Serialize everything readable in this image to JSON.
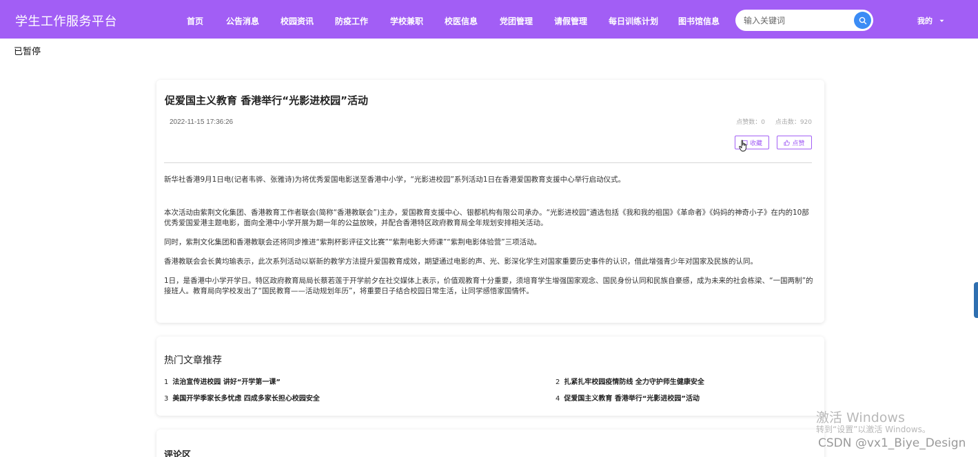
{
  "header": {
    "brand": "学生工作服务平台",
    "nav": [
      "首页",
      "公告消息",
      "校园资讯",
      "防疫工作",
      "学校兼职",
      "校医信息",
      "党团管理",
      "请假管理",
      "每日训练计划",
      "图书馆信息"
    ],
    "search_placeholder": "输入关键词",
    "user_label": "我的",
    "colors": {
      "bar": "#a25ef5",
      "search_button": "#3b8cf5"
    }
  },
  "stray_text": "已暂停",
  "article": {
    "title": "促爱国主义教育 香港举行“光影进校园”活动",
    "date": "2022-11-15 17:36:26",
    "likes_label": "点赞数：0",
    "clicks_label": "点击数：920",
    "collect_button": "收藏",
    "like_button": "点赞",
    "paragraphs": [
      "新华社香港9月1日电(记者韦骅、张雅诗)为将优秀爱国电影送至香港中小学，“光影进校园”系列活动1日在香港爱国教育支援中心举行启动仪式。",
      "本次活动由紫荆文化集团、香港教育工作者联会(简称“香港教联会”)主办，爱国教育支援中心、银都机构有限公司承办。“光影进校园”遴选包括《我和我的祖国》《革命者》《妈妈的神奇小子》在内的10部优秀爱国爱港主题电影，面向全港中小学开展为期一年的公益放映，并配合香港特区政府教育局全年规划安排相关活动。",
      "同时，紫荆文化集团和香港教联会还将同步推进“紫荆杯影评征文比赛”“紫荆电影大师课”“紫荆电影体验营”三项活动。",
      "香港教联会会长黄均瑜表示，此次系列活动以崭新的教学方法提升爱国教育成效，期望通过电影的声、光、影深化学生对国家重要历史事件的认识，借此增强青少年对国家及民族的认同。",
      "1日，是香港中小学开学日。特区政府教育局局长蔡若莲于开学前夕在社交媒体上表示，价值观教育十分重要，须培育学生增强国家观念、国民身份认同和民族自豪感，成为未来的社会栋梁、“一国两制”的接班人。教育局向学校发出了“国民教育——活动规划年历”，将重要日子结合校园日常生活，让同学感悟家国情怀。"
    ]
  },
  "hot": {
    "title": "热门文章推荐",
    "items": [
      {
        "num": "1",
        "title": "法治宣传进校园 讲好“开学第一课”"
      },
      {
        "num": "2",
        "title": "扎紧扎牢校园疫情防线 全力守护师生健康安全"
      },
      {
        "num": "3",
        "title": "美国开学季家长多忧虑 四成多家长担心校园安全"
      },
      {
        "num": "4",
        "title": "促爱国主义教育 香港举行“光影进校园”活动"
      }
    ]
  },
  "comments": {
    "title": "评论区"
  },
  "watermark": {
    "line1": "激活 Windows",
    "line2": "转到“设置”以激活 Windows。",
    "line3": "CSDN @vx1_Biye_Design"
  }
}
